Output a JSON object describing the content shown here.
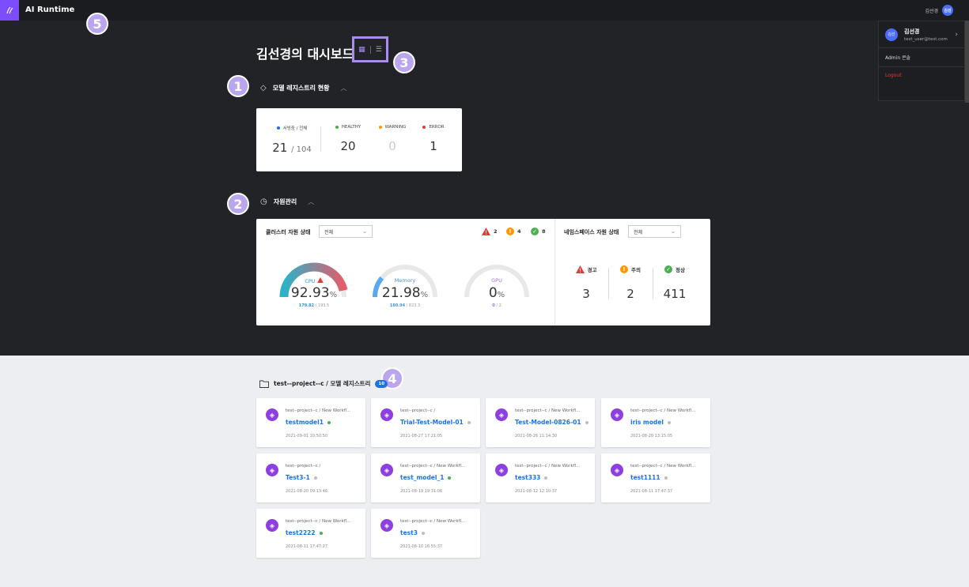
{
  "app": {
    "title": "AI Runtime"
  },
  "topbar": {
    "user_name": "김선경",
    "avatar_text": "김선"
  },
  "user_menu": {
    "avatar_text": "김선",
    "name": "김선경",
    "email": "test_user@test.com",
    "admin_label": "Admin 콘솔",
    "logout_label": "Logout"
  },
  "annotations": [
    "1",
    "2",
    "3",
    "4",
    "5"
  ],
  "dashboard": {
    "title": "김선경의 대시보드"
  },
  "registry": {
    "section_title": "모델 레지스트리 현황",
    "serving": {
      "label": "서빙중 / 전체",
      "value": "21",
      "total": "/ 104"
    },
    "healthy": {
      "label": "HEALTHY",
      "value": "20"
    },
    "warning": {
      "label": "WARNING",
      "value": "0"
    },
    "error": {
      "label": "ERROR",
      "value": "1"
    }
  },
  "resources": {
    "section_title": "자원관리",
    "cluster": {
      "title": "클러스터 자원 상태",
      "select_value": "전체",
      "status": {
        "error": "2",
        "warning": "4",
        "ok": "8"
      },
      "gauges": [
        {
          "label": "CPU",
          "pct": "92.93",
          "unit": "%",
          "used": "179.82",
          "total": "/ 193.5",
          "ratio": 0.9293,
          "color": "#e35d6a"
        },
        {
          "label": "Memory",
          "pct": "21.98",
          "unit": "%",
          "used": "180.94",
          "total": "/ 823.3",
          "ratio": 0.2198,
          "color": "#5aa9f0"
        },
        {
          "label": "GPU",
          "pct": "0",
          "unit": "%",
          "used": "0",
          "total": "/ 2",
          "ratio": 0,
          "color": "#9b6cf0"
        }
      ]
    },
    "namespace": {
      "title": "네임스페이스 자원 상태",
      "select_value": "전체",
      "warn_label": "경고",
      "warn_value": "3",
      "caution_label": "주의",
      "caution_value": "2",
      "normal_label": "정상",
      "normal_value": "411"
    }
  },
  "project": {
    "title": "test--project--c / 모델 레지스트리",
    "count": "10",
    "models": [
      {
        "path": "test--project--c / New Workfl...",
        "name": "testmodel1",
        "status": "green",
        "date": "2021-09-01 10:50:50"
      },
      {
        "path": "test--project--c /",
        "name": "Trial-Test-Model-01",
        "status": "gray",
        "date": "2021-08-27 17:21:05"
      },
      {
        "path": "test--project--c / New Workfl...",
        "name": "Test-Model-0826-01",
        "status": "gray",
        "date": "2021-08-26 11:14:30"
      },
      {
        "path": "test--project--c / New Workfl...",
        "name": "iris model",
        "status": "gray",
        "date": "2021-08-20 13:15:05"
      },
      {
        "path": "test--project--c /",
        "name": "Test3-1",
        "status": "gray",
        "date": "2021-08-20 09:13:46"
      },
      {
        "path": "test--project--c / New Workfl...",
        "name": "test_model_1",
        "status": "green",
        "date": "2021-08-19 19:31:06"
      },
      {
        "path": "test--project--c / New Workfl...",
        "name": "test333",
        "status": "gray",
        "date": "2021-08-12 12:10:37"
      },
      {
        "path": "test--project--c / New Workfl...",
        "name": "test1111",
        "status": "gray",
        "date": "2021-08-11 17:47:37"
      },
      {
        "path": "test--project--c / New Workfl...",
        "name": "test2222",
        "status": "green",
        "date": "2021-08-11 17:47:27"
      },
      {
        "path": "test--project--c / New Workfl...",
        "name": "test3",
        "status": "gray",
        "date": "2021-08-10 16:55:37"
      }
    ]
  },
  "colors": {
    "accent": "#7c4dff",
    "link": "#1a73e8",
    "healthy": "#4caf50",
    "warning": "#ff9800",
    "error": "#e53935",
    "inactive": "#bdbdbd"
  }
}
